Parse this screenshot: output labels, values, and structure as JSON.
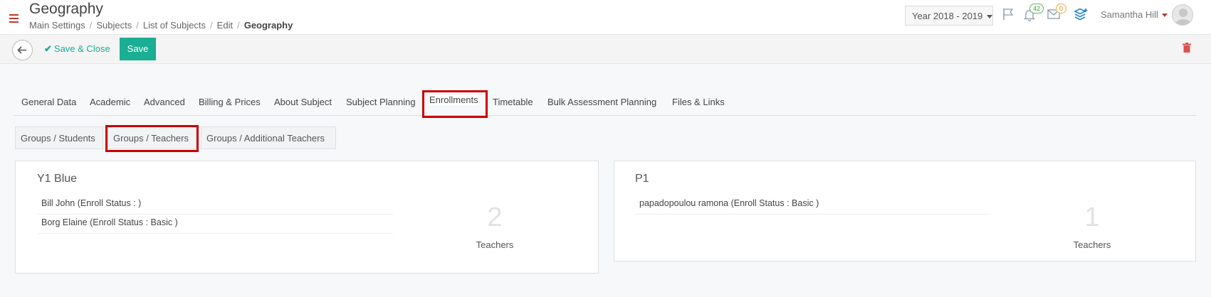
{
  "header": {
    "title": "Geography",
    "breadcrumb": [
      "Main Settings",
      "Subjects",
      "List of Subjects",
      "Edit"
    ],
    "breadcrumb_current": "Geography",
    "year_select": "Year 2018 - 2019",
    "notifications_count": "42",
    "messages_count": "0",
    "user_name": "Samantha Hill"
  },
  "toolbar": {
    "save_close_label": "Save & Close",
    "save_label": "Save"
  },
  "tabs": [
    "General Data",
    "Academic",
    "Advanced",
    "Billing & Prices",
    "About Subject",
    "Subject Planning",
    "Enrollments",
    "Timetable",
    "Bulk Assessment Planning",
    "Files & Links"
  ],
  "active_tab": "Enrollments",
  "subtabs": [
    "Groups / Students",
    "Groups / Teachers",
    "Groups / Additional Teachers"
  ],
  "active_subtab": "Groups / Teachers",
  "groups": [
    {
      "name": "Y1 Blue",
      "teachers": [
        "Bill John (Enroll Status : )",
        "Borg Elaine (Enroll Status : Basic )"
      ],
      "count": "2",
      "count_label": "Teachers"
    },
    {
      "name": "P1",
      "teachers": [
        "papadopoulou ramona (Enroll Status : Basic )"
      ],
      "count": "1",
      "count_label": "Teachers"
    }
  ],
  "colors": {
    "accent": "#1aae94",
    "highlight": "#cc0000",
    "menu": "#c0392b"
  },
  "icons": [
    "menu-icon",
    "flag-icon",
    "bell-icon",
    "envelope-icon",
    "layers-icon",
    "back-arrow-icon",
    "check-icon",
    "trash-icon"
  ]
}
